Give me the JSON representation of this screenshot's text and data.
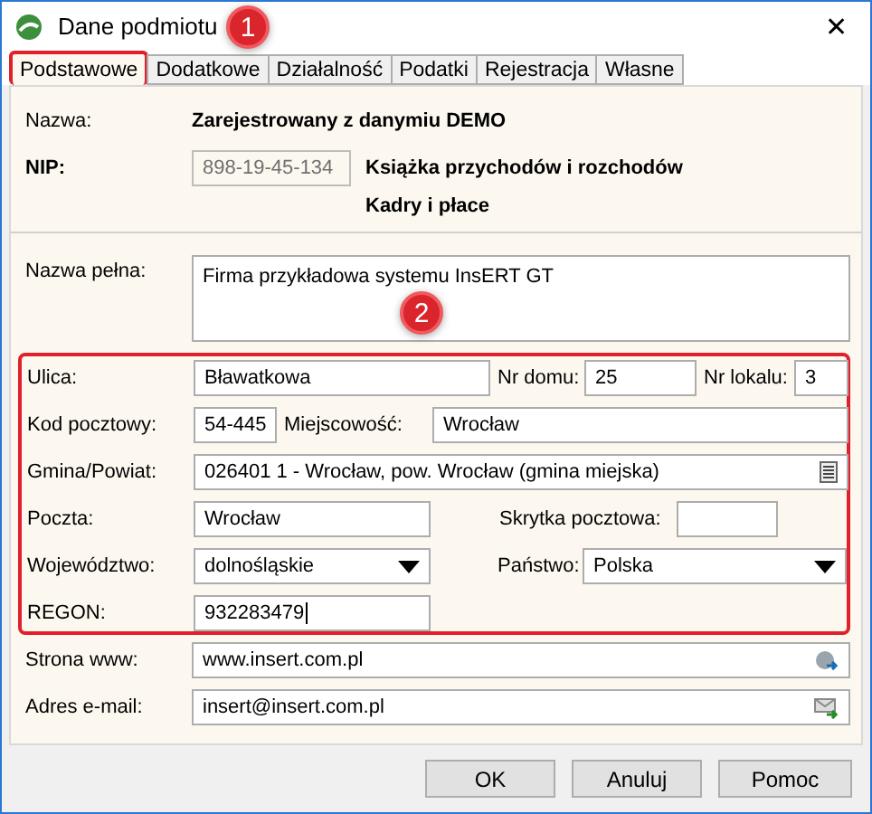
{
  "window": {
    "title": "Dane podmiotu",
    "close": "✕"
  },
  "tabs": [
    {
      "label": "Podstawowe",
      "selected": true,
      "highlighted": true
    },
    {
      "label": "Dodatkowe",
      "selected": false,
      "highlighted": false
    },
    {
      "label": "Działalność",
      "selected": false,
      "highlighted": false
    },
    {
      "label": "Podatki",
      "selected": false,
      "highlighted": false
    },
    {
      "label": "Rejestracja",
      "selected": false,
      "highlighted": false
    },
    {
      "label": "Własne",
      "selected": false,
      "highlighted": false
    }
  ],
  "name": {
    "label": "Nazwa:",
    "value": "Zarejestrowany z danymiu DEMO"
  },
  "nip": {
    "label": "NIP:",
    "value": "898-19-45-134",
    "disabled": true
  },
  "modules": [
    "Książka przychodów i rozchodów",
    "Kadry i płace"
  ],
  "full_name": {
    "label": "Nazwa pełna:",
    "value": "Firma przykładowa systemu InsERT GT"
  },
  "address": {
    "highlighted": true,
    "street": {
      "label": "Ulica:",
      "value": "Bławatkowa"
    },
    "house_no": {
      "label": "Nr domu:",
      "value": "25"
    },
    "flat_no": {
      "label": "Nr lokalu:",
      "value": "3"
    },
    "postal_code": {
      "label": "Kod pocztowy:",
      "value": "54-445"
    },
    "city": {
      "label": "Miejscowość:",
      "value": "Wrocław"
    },
    "commune": {
      "label": "Gmina/Powiat:",
      "value": "026401 1 - Wrocław, pow. Wrocław (gmina miejska)"
    },
    "post_office": {
      "label": "Poczta:",
      "value": "Wrocław"
    },
    "po_box": {
      "label": "Skrytka pocztowa:"
    },
    "voivodeship": {
      "label": "Województwo:",
      "value": "dolnośląskie"
    },
    "country": {
      "label": "Państwo:",
      "value": "Polska"
    },
    "regon": {
      "label": "REGON:",
      "value": "932283479",
      "focused": true
    }
  },
  "website": {
    "label": "Strona www:",
    "value": "www.insert.com.pl"
  },
  "email": {
    "label": "Adres e-mail:",
    "value": "insert@insert.com.pl"
  },
  "buttons": [
    "OK",
    "Anuluj",
    "Pomoc"
  ],
  "annotations": [
    {
      "number": "1"
    },
    {
      "number": "2"
    }
  ]
}
